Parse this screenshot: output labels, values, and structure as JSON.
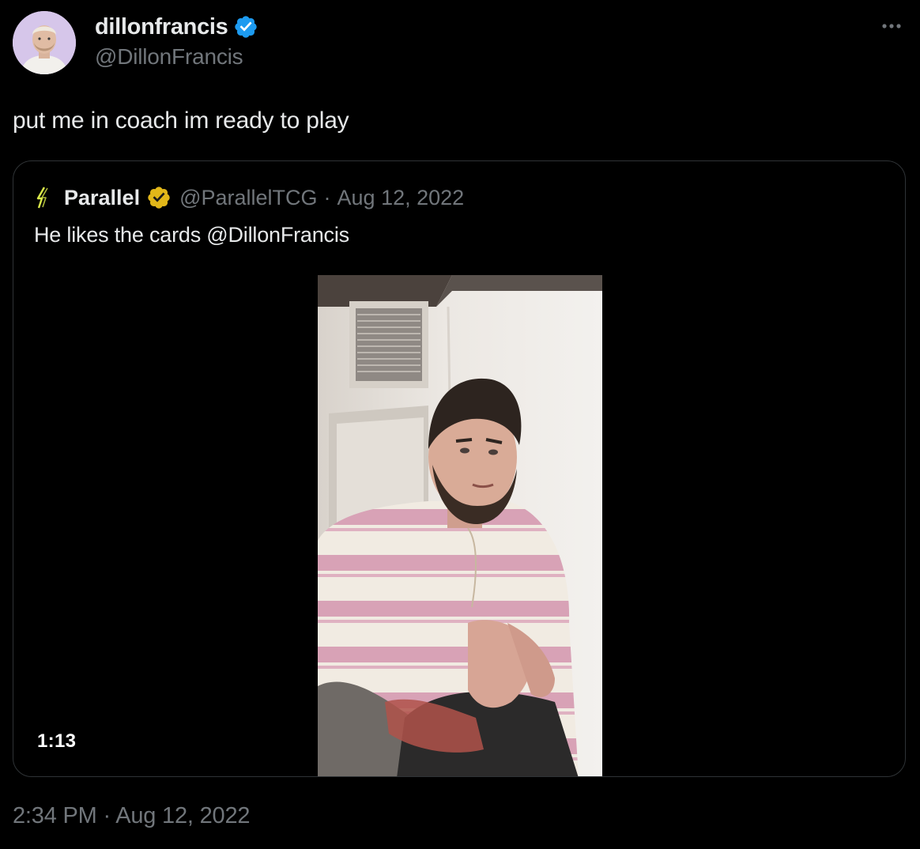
{
  "author": {
    "display_name": "dillonfrancis",
    "handle": "@DillonFrancis",
    "verified_icon": "blue-verified-badge-icon",
    "avatar_icon": "avatar"
  },
  "more_icon": "more-horizontal-icon",
  "tweet": {
    "text": "put me in coach im ready to play"
  },
  "quoted_tweet": {
    "logo_icon": "parallel-logo-icon",
    "display_name": "Parallel",
    "verified_icon": "gold-verified-badge-icon",
    "handle": "@ParallelTCG",
    "separator": "·",
    "date": "Aug 12, 2022",
    "text": "He likes the cards @DillonFrancis",
    "video": {
      "duration": "1:13"
    }
  },
  "timestamp": {
    "time": "2:34 PM",
    "separator": " · ",
    "date": "Aug 12, 2022"
  },
  "colors": {
    "background": "#000000",
    "primary_text": "#e7e9ea",
    "secondary_text": "#71767b",
    "border": "#2f3336",
    "verified_blue": "#1d9bf0",
    "verified_gold": "#e2b719"
  }
}
